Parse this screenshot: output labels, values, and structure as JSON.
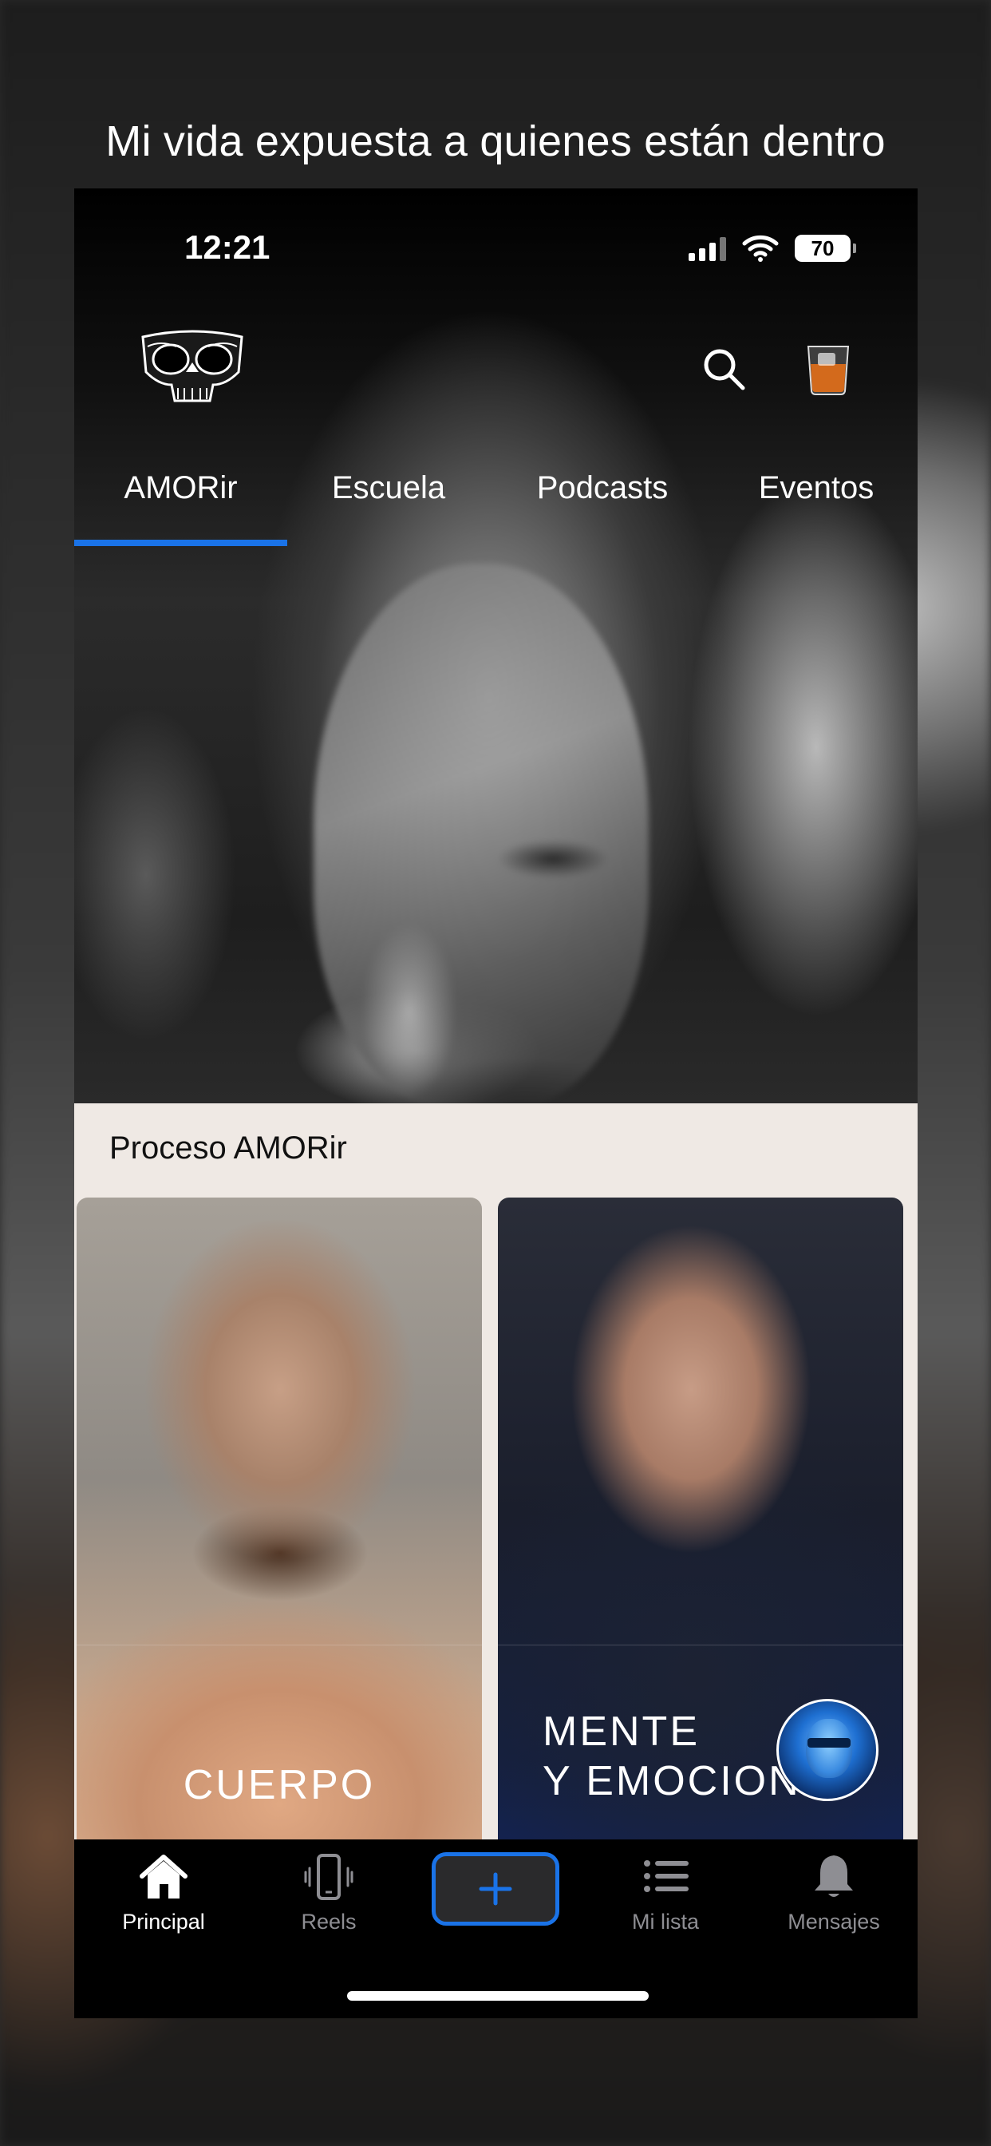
{
  "promo": {
    "title": "Mi vida expuesta a quienes están dentro"
  },
  "status_bar": {
    "time": "12:21",
    "battery": "70"
  },
  "header": {
    "logo_icon": "skull-logo-icon",
    "search_icon": "search-icon",
    "glass_icon": "whisky-glass-icon"
  },
  "tabs": [
    {
      "label": "AMORir",
      "active": true
    },
    {
      "label": "Escuela",
      "active": false
    },
    {
      "label": "Podcasts",
      "active": false
    },
    {
      "label": "Eventos",
      "active": false
    }
  ],
  "accent_color": "#1a73e8",
  "section": {
    "title": "Proceso AMORir",
    "cards": [
      {
        "label": "CUERPO"
      },
      {
        "label_line1": "MENTE",
        "label_line2": "Y EMOCIONES"
      }
    ]
  },
  "bottom_nav": {
    "items": [
      {
        "label": "Principal",
        "icon": "home-icon",
        "active": true
      },
      {
        "label": "Reels",
        "icon": "phone-vibrate-icon",
        "active": false
      },
      {
        "label": "",
        "icon": "plus-icon",
        "active": false
      },
      {
        "label": "Mi lista",
        "icon": "list-icon",
        "active": false
      },
      {
        "label": "Mensajes",
        "icon": "bell-icon",
        "active": false
      }
    ]
  }
}
